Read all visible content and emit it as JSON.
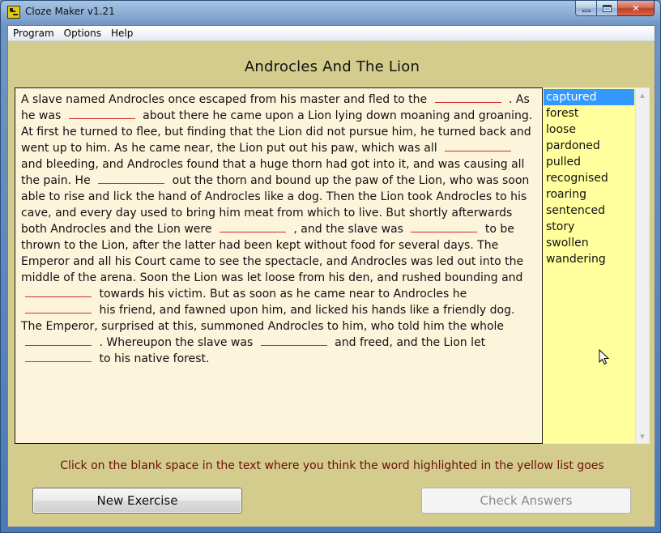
{
  "window": {
    "title": "Cloze Maker v1.21",
    "controls": {
      "minimize": "minimize",
      "maximize": "maximize",
      "close": "✕"
    }
  },
  "menu": {
    "items": [
      {
        "label": "Program"
      },
      {
        "label": "Options"
      },
      {
        "label": "Help"
      }
    ]
  },
  "exercise": {
    "title": "Androcles And The Lion",
    "passage": [
      {
        "t": "A slave named Androcles once escaped from his master and fled to the"
      },
      {
        "blank": 1
      },
      {
        "t": ". As he was"
      },
      {
        "blank": 2
      },
      {
        "t": "about there he came upon a Lion lying down moaning and groaning. At first he turned to flee, but finding that the Lion did not pursue him, he turned back and went up to him. As he came near, the Lion put out his paw, which was all"
      },
      {
        "blank": 3
      },
      {
        "t": "and bleeding, and Androcles found that a huge thorn had got into it, and was causing all the pain. He"
      },
      {
        "blank": 4
      },
      {
        "t": "out the thorn and bound up the paw of the Lion, who was soon able to rise and lick the hand of Androcles like a dog. Then the Lion took Androcles to his cave, and every day used to bring him meat from which to live. But shortly afterwards both Androcles and the Lion were"
      },
      {
        "blank": 5
      },
      {
        "t": ", and the slave was"
      },
      {
        "blank": 6
      },
      {
        "t": "to be thrown to the Lion, after the latter had been kept without food for several days. The Emperor and all his Court came to see the spectacle, and Androcles was led out into the middle of the arena. Soon the Lion was let loose from his den, and rushed bounding and"
      },
      {
        "blank": 7
      },
      {
        "t": "towards his victim. But as soon as he came near to Androcles he"
      },
      {
        "blank": 8
      },
      {
        "t": "his friend, and fawned upon him, and licked his hands like a friendly dog. The Emperor, surprised at this, summoned Androcles to him, who told him the whole"
      },
      {
        "blank": 9
      },
      {
        "t": ". Whereupon the slave was"
      },
      {
        "blank": 10
      },
      {
        "t": "and freed, and the Lion let"
      },
      {
        "blank": 11
      },
      {
        "t": "to his native forest."
      }
    ],
    "blank_color": "#d42a2a"
  },
  "word_list": {
    "selected_index": 0,
    "items": [
      "captured",
      "forest",
      "loose",
      "pardoned",
      "pulled",
      "recognised",
      "roaring",
      "sentenced",
      "story",
      "swollen",
      "wandering"
    ],
    "background": "#ffff9e",
    "highlight": "#3399ff"
  },
  "instruction": "Click on the blank space in the text where you think the word highlighted in the yellow list goes",
  "buttons": {
    "new_exercise": "New Exercise",
    "check_answers": "Check Answers"
  },
  "colors": {
    "client_bg": "#d4cc8c",
    "text_bg": "#fdf4dc",
    "instruction": "#6a0f0f"
  }
}
